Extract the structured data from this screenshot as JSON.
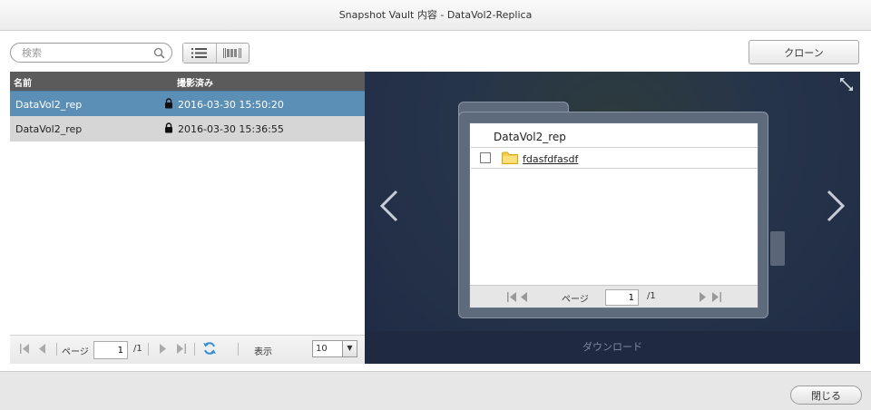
{
  "window": {
    "title": "Snapshot Vault 内容 - DataVol2-Replica"
  },
  "toolbar": {
    "search_placeholder": "検索",
    "clone_label": "クローン"
  },
  "table": {
    "headers": {
      "name": "名前",
      "taken": "撮影済み"
    },
    "rows": [
      {
        "name": "DataVol2_rep",
        "taken": "2016-03-30 15:50:20",
        "selected": true
      },
      {
        "name": "DataVol2_rep",
        "taken": "2016-03-30 15:36:55",
        "selected": false
      }
    ]
  },
  "pager": {
    "page_label": "ページ",
    "page_value": "1",
    "total": "/1",
    "display_label": "表示",
    "per_page": "10"
  },
  "preview": {
    "folder_title": "DataVol2_rep",
    "item_name": "fdasfdfasdf",
    "page_label": "ページ",
    "page_value": "1",
    "total": "/1",
    "download_label": "ダウンロード"
  },
  "footer": {
    "close_label": "閉じる"
  },
  "colors": {
    "selected_row": "#5b8fb5",
    "header_bg": "#5b5b5b",
    "preview_bg": "#24324a",
    "refresh_icon": "#3a8fd0",
    "folder_icon": "#f5cf4a"
  }
}
